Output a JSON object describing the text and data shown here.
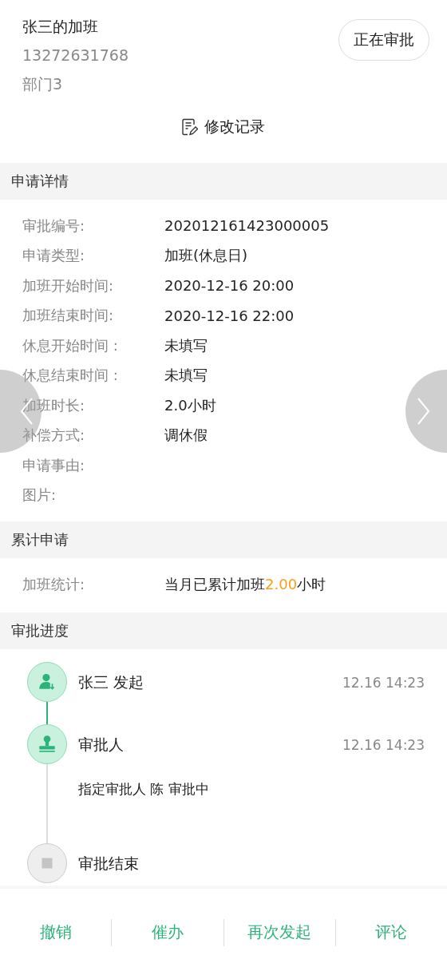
{
  "header": {
    "title": "张三的加班",
    "phone": "13272631768",
    "department": "部门3",
    "status": "正在审批"
  },
  "history_link": "修改记录",
  "details": {
    "title": "申请详情",
    "fields": [
      {
        "label": "审批编号:",
        "value": "202012161423000005"
      },
      {
        "label": "申请类型:",
        "value": "加班(休息日)"
      },
      {
        "label": "加班开始时间:",
        "value": "2020-12-16 20:00"
      },
      {
        "label": "加班结束时间:",
        "value": "2020-12-16 22:00"
      },
      {
        "label": "休息开始时间 :",
        "value": "未填写"
      },
      {
        "label": "休息结束时间 :",
        "value": "未填写"
      },
      {
        "label": "加班时长:",
        "value": "2.0小时"
      },
      {
        "label": "补偿方式:",
        "value": "调休假"
      },
      {
        "label": "申请事由:"
      },
      {
        "label": "图片:"
      }
    ]
  },
  "summary": {
    "title": "累计申请",
    "label": "加班统计:",
    "prefix": "当月已累计加班",
    "amount": "2.00",
    "suffix": "小时"
  },
  "progress": {
    "title": "审批进度",
    "steps": [
      {
        "kind": "start",
        "done": true,
        "name": "张三 发起",
        "time": "12.16 14:23"
      },
      {
        "kind": "approve",
        "done": true,
        "name": "审批人",
        "time": "12.16 14:23",
        "note": "指定审批人 陈 审批中"
      },
      {
        "kind": "end",
        "done": false,
        "name": "审批结束"
      }
    ]
  },
  "actions": [
    "撤销",
    "催办",
    "再次发起",
    "评论"
  ]
}
